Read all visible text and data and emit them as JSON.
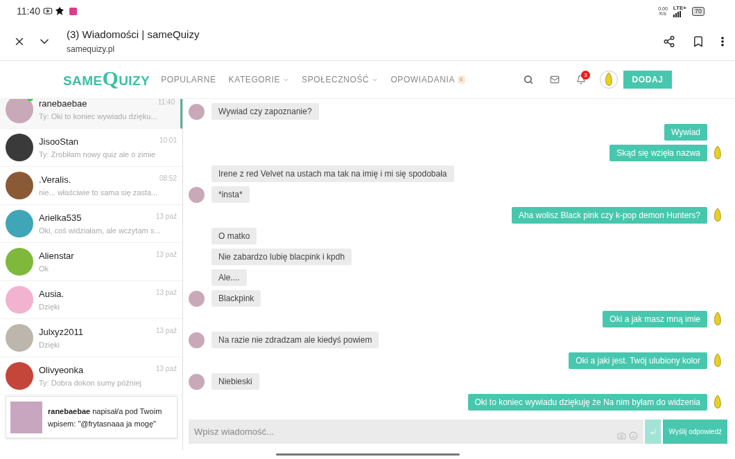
{
  "status_bar": {
    "time": "11:40",
    "net_speed": "0.00",
    "net_unit": "K/s",
    "network": "LTE+",
    "battery": "70"
  },
  "browser": {
    "title": "(3) Wiadomości | sameQuizy",
    "url": "samequizy.pl"
  },
  "site_nav": {
    "logo": [
      "SAME",
      "Q",
      "UIZY"
    ],
    "items": [
      {
        "label": "POPULARNE",
        "dropdown": false
      },
      {
        "label": "KATEGORIE",
        "dropdown": true
      },
      {
        "label": "SPOŁECZNOŚĆ",
        "dropdown": true
      },
      {
        "label": "OPOWIADANIA",
        "dropdown": false,
        "badge": "6"
      }
    ],
    "notification_count": "3",
    "add_button": "DODAJ"
  },
  "conversations": [
    {
      "name": "ranebaebae",
      "preview": "Ty: Oki to koniec wywiadu dzięku...",
      "time": "11:40",
      "selected": true,
      "online": true,
      "color": "#c9a9b8"
    },
    {
      "name": "JisooStan",
      "preview": "Ty: Zrobiłam nowy quiz ale o zimie",
      "time": "10:01",
      "selected": false,
      "online": false,
      "color": "#3a3a3a"
    },
    {
      "name": ".Veralis.",
      "preview": "nie... właściwie to sama się zasta...",
      "time": "08:52",
      "selected": false,
      "online": false,
      "color": "#8a5a36"
    },
    {
      "name": "Arielka535",
      "preview": "Oki, coś widziałam, ale wczytam s...",
      "time": "13 paź",
      "selected": false,
      "online": false,
      "color": "#3fa6b8"
    },
    {
      "name": "Alienstar",
      "preview": "Ok",
      "time": "13 paź",
      "selected": false,
      "online": false,
      "color": "#7fb83a"
    },
    {
      "name": "Ausia.",
      "preview": "Dzięki",
      "time": "13 paź",
      "selected": false,
      "online": false,
      "color": "#f2b3d0"
    },
    {
      "name": "Julxyz2011",
      "preview": "Dzięki",
      "time": "13 paź",
      "selected": false,
      "online": false,
      "color": "#bdb6ad"
    },
    {
      "name": "Olivyeonka",
      "preview": "Ty: Dobra dokon sumy później",
      "time": "13 paź",
      "selected": false,
      "online": false,
      "color": "#c4453a"
    }
  ],
  "notification_popup": {
    "text": "**ranebaebae** napisał/a pod Twoim wpisem: \"@frytasnaaa ja mogę\""
  },
  "messages": [
    {
      "kind": "received",
      "text": "Wywiad czy zapoznanie?",
      "avatar": true
    },
    {
      "kind": "sent",
      "text": "Wywiad",
      "avatar": false
    },
    {
      "kind": "sent",
      "text": "Skąd się wzięła nazwa",
      "avatar": true
    },
    {
      "kind": "received",
      "text": "Irene z red Velvet na ustach ma tak na imię i mi się spodobała",
      "avatar": false
    },
    {
      "kind": "received",
      "text": "*insta*",
      "avatar": true
    },
    {
      "kind": "sent",
      "text": "Aha wolisz Black pink czy k-pop demon Hunters?",
      "avatar": true
    },
    {
      "kind": "received",
      "text": "O matko",
      "avatar": false
    },
    {
      "kind": "received",
      "text": "Nie zabardzo lubię blacpink i kpdh",
      "avatar": false
    },
    {
      "kind": "received",
      "text": "Ale....",
      "avatar": false
    },
    {
      "kind": "received",
      "text": "Blackpink",
      "avatar": true
    },
    {
      "kind": "sent",
      "text": "Oki a jak masz mną imie",
      "avatar": true
    },
    {
      "kind": "received",
      "text": "Na razie nie zdradzam ale kiedyś powiem",
      "avatar": true
    },
    {
      "kind": "sent",
      "text": "Oki a jaki jest. Twój ulubiony kolor",
      "avatar": true
    },
    {
      "kind": "received",
      "text": "Niebieski",
      "avatar": true
    },
    {
      "kind": "sent",
      "text": "Oki to koniec wywiadu dziękuję że Na nim byłam do widzenia",
      "avatar": true
    }
  ],
  "composer": {
    "placeholder": "Wpisz wiadomość...",
    "send_button": "Wyślij odpowiedź"
  }
}
